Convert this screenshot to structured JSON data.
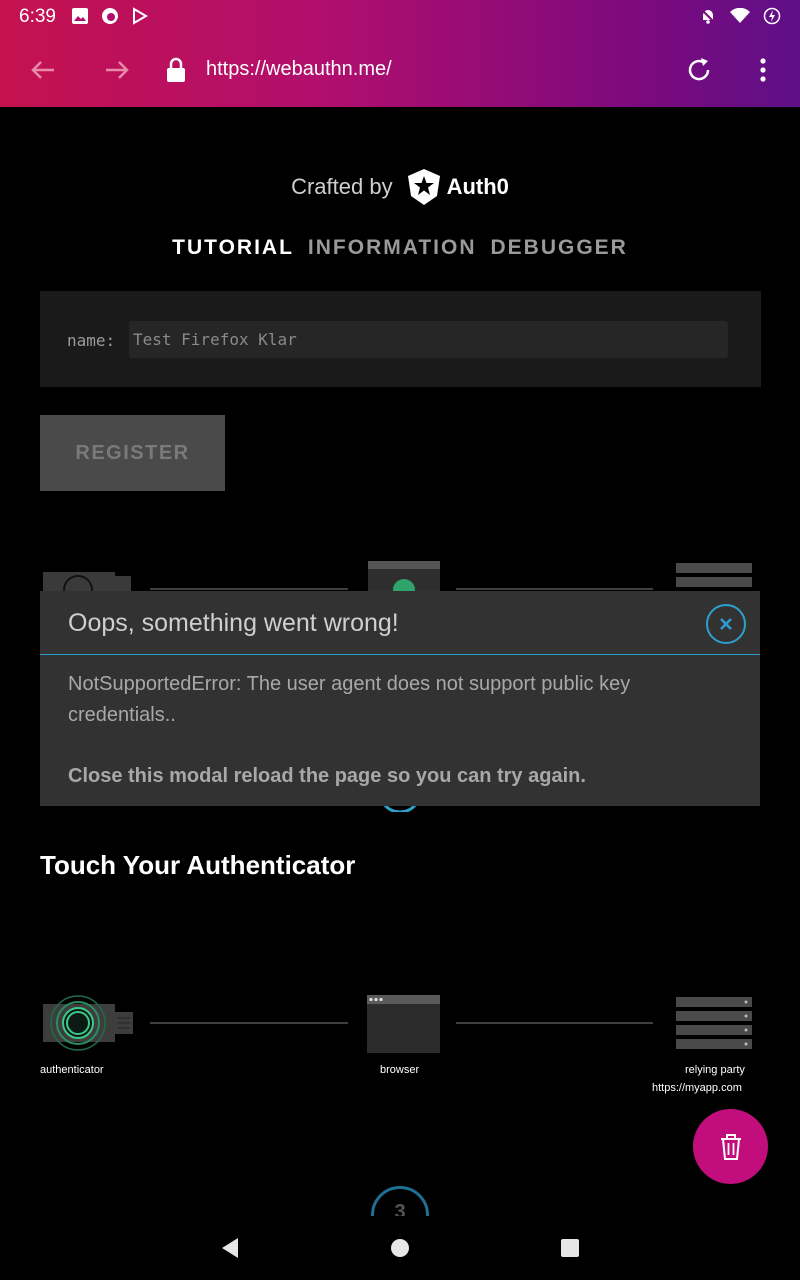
{
  "status": {
    "time": "6:39"
  },
  "browser": {
    "url": "https://webauthn.me/"
  },
  "header": {
    "crafted_by": "Crafted by",
    "brand": "Auth0"
  },
  "tabs": [
    {
      "label": "TUTORIAL",
      "active": true
    },
    {
      "label": "INFORMATION",
      "active": false
    },
    {
      "label": "DEBUGGER",
      "active": false
    }
  ],
  "form": {
    "name_label": "name:",
    "name_value": "Test Firefox Klar",
    "register_label": "REGISTER"
  },
  "modal": {
    "title": "Oops, something went wrong!",
    "message": "NotSupportedError: The user agent does not support public key credentials..",
    "note": "Close this modal reload the page so you can try again."
  },
  "section": {
    "title": "Touch Your Authenticator"
  },
  "diagram": {
    "authenticator_label": "authenticator",
    "browser_label": "browser",
    "relying_party_label": "relying party",
    "relying_party_url": "https://myapp.com",
    "step_number": "3"
  },
  "colors": {
    "accent": "#2d9fcf",
    "fab": "#c20e7c",
    "green": "#3cc88a"
  },
  "icons": [
    "back-arrow-icon",
    "forward-arrow-icon",
    "lock-icon",
    "reload-icon",
    "menu-dots-icon",
    "trash-icon",
    "close-icon"
  ]
}
